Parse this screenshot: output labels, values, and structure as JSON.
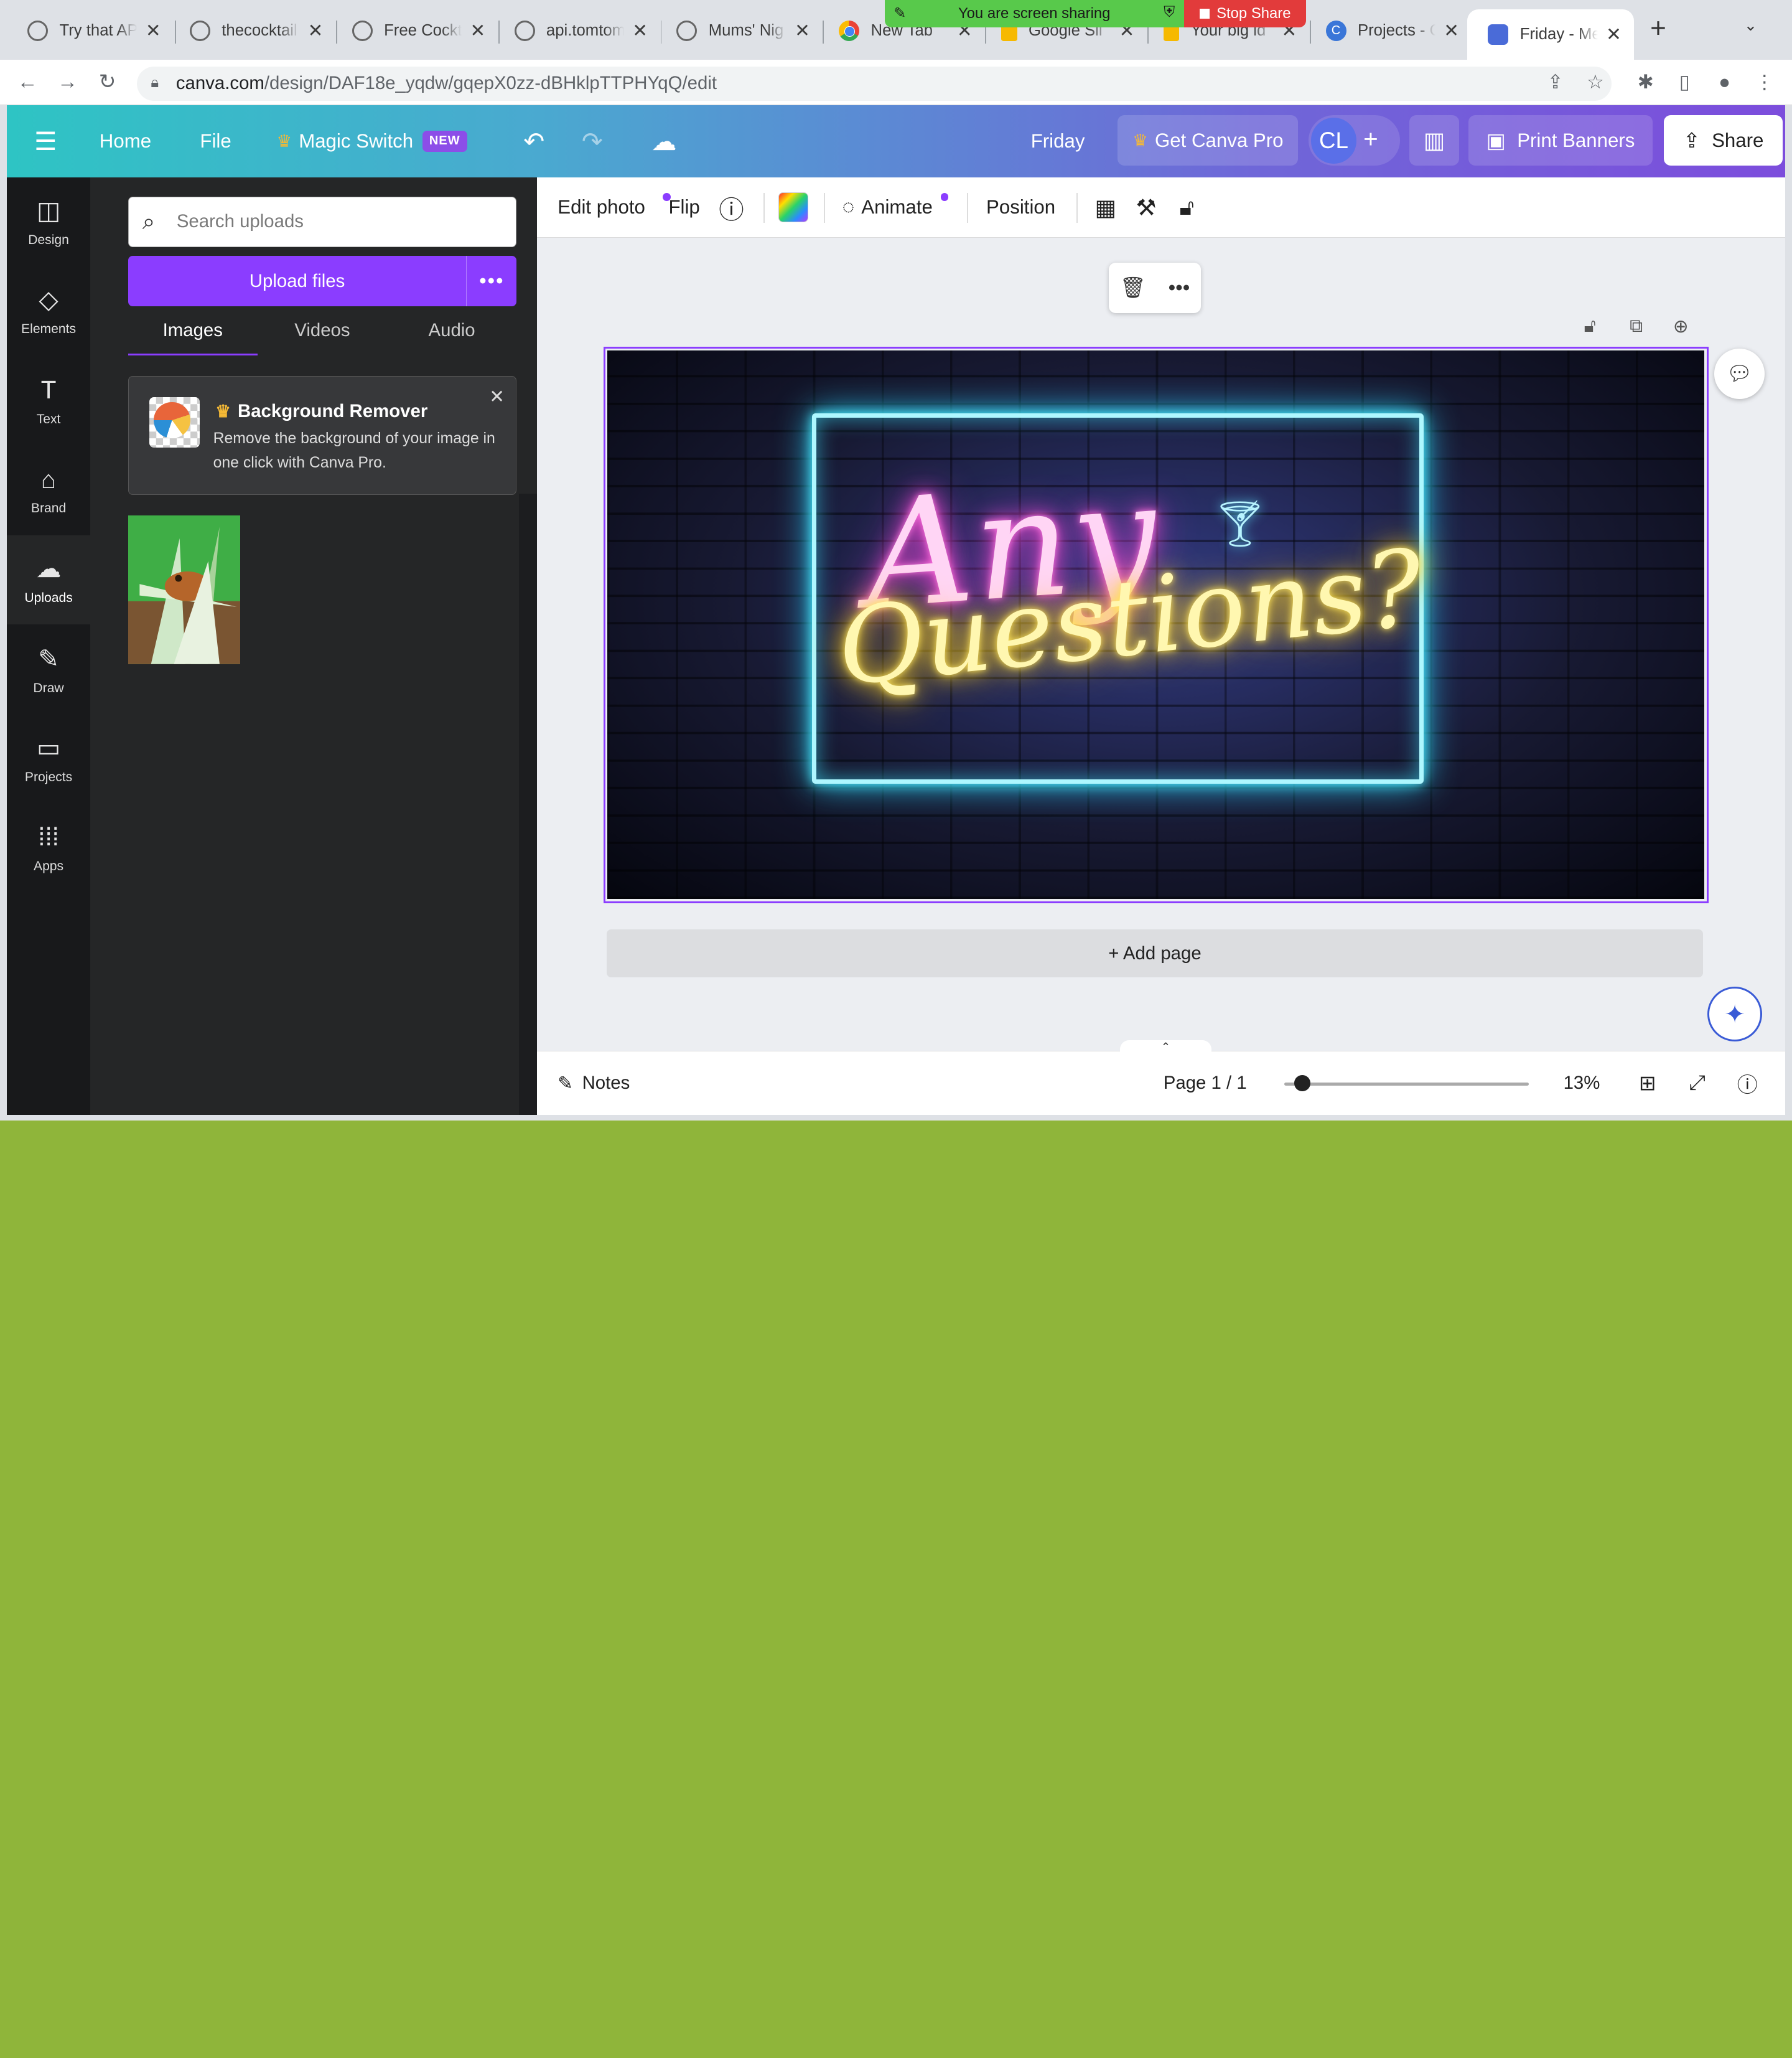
{
  "browser": {
    "tabs": [
      {
        "title": "Try that AP",
        "fav": ""
      },
      {
        "title": "thecocktail",
        "fav": ""
      },
      {
        "title": "Free Cockt",
        "fav": ""
      },
      {
        "title": "api.tomtom",
        "fav": ""
      },
      {
        "title": "Mums' Nig",
        "fav": ""
      },
      {
        "title": "New Tab",
        "fav": ""
      },
      {
        "title": "Google Sli",
        "fav": ""
      },
      {
        "title": "Your big id",
        "fav": ""
      },
      {
        "title": "Projects - C",
        "fav": ""
      },
      {
        "title": "Friday - Me",
        "fav": ""
      }
    ],
    "close_glyph": "✕",
    "new_tab": "+",
    "menu_glyph": "⌄",
    "sharing_text": "You are screen sharing",
    "stop_share": "Stop Share",
    "url_domain": "canva.com",
    "url_path": "/design/DAF18e_yqdw/gqepX0zz-dBHklpTTPHYqQ/edit"
  },
  "header": {
    "home": "Home",
    "file": "File",
    "magic_switch": "Magic Switch",
    "new_badge": "NEW",
    "doc_title": "Friday",
    "get_pro": "Get Canva Pro",
    "avatar_initials": "CL",
    "print_banners": "Print Banners",
    "share": "Share"
  },
  "rail": {
    "items": [
      {
        "label": "Design",
        "icon": "design-icon"
      },
      {
        "label": "Elements",
        "icon": "elements-icon"
      },
      {
        "label": "Text",
        "icon": "text-icon"
      },
      {
        "label": "Brand",
        "icon": "brand-icon"
      },
      {
        "label": "Uploads",
        "icon": "uploads-icon"
      },
      {
        "label": "Draw",
        "icon": "draw-icon"
      },
      {
        "label": "Projects",
        "icon": "projects-icon"
      },
      {
        "label": "Apps",
        "icon": "apps-icon"
      }
    ]
  },
  "panel": {
    "search_placeholder": "Search uploads",
    "upload_label": "Upload files",
    "tabs": [
      "Images",
      "Videos",
      "Audio"
    ],
    "promo_title": "Background Remover",
    "promo_desc": "Remove the background of your image in one click with Canva Pro."
  },
  "toolbar": {
    "edit_photo": "Edit photo",
    "flip": "Flip",
    "animate": "Animate",
    "position": "Position"
  },
  "canvas": {
    "line1": "Any",
    "line2": "Questions?"
  },
  "editor": {
    "add_page": "+ Add page",
    "notes": "Notes",
    "page": "Page 1 / 1",
    "zoom": "13%",
    "zoom_level": 0.13
  },
  "colors": {
    "accent": "#8b3dff",
    "header_start": "#2ec4c4",
    "header_end": "#7c4ddc"
  }
}
